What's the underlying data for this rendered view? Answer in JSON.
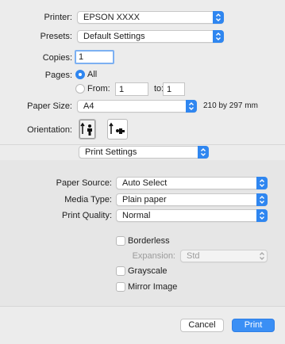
{
  "printer": {
    "label": "Printer:",
    "value": "EPSON XXXX"
  },
  "presets": {
    "label": "Presets:",
    "value": "Default Settings"
  },
  "copies": {
    "label": "Copies:",
    "value": "1"
  },
  "pages": {
    "label": "Pages:",
    "all_label": "All",
    "from_label": "From:",
    "from_value": "1",
    "to_label": "to:",
    "to_value": "1",
    "selected": "All"
  },
  "paper_size": {
    "label": "Paper Size:",
    "value": "A4",
    "dimensions": "210 by 297 mm"
  },
  "orientation": {
    "label": "Orientation:",
    "selected": "portrait",
    "icons": [
      "portrait-icon",
      "landscape-icon"
    ]
  },
  "section_menu": {
    "value": "Print Settings"
  },
  "paper_source": {
    "label": "Paper Source:",
    "value": "Auto Select"
  },
  "media_type": {
    "label": "Media Type:",
    "value": "Plain paper"
  },
  "print_quality": {
    "label": "Print Quality:",
    "value": "Normal"
  },
  "borderless": {
    "label": "Borderless",
    "checked": false
  },
  "expansion": {
    "label": "Expansion:",
    "value": "Std",
    "enabled": false
  },
  "grayscale": {
    "label": "Grayscale",
    "checked": false
  },
  "mirror_image": {
    "label": "Mirror Image",
    "checked": false
  },
  "buttons": {
    "cancel": "Cancel",
    "print": "Print"
  },
  "colors": {
    "accent": "#2f86f0",
    "background": "#ececec"
  }
}
